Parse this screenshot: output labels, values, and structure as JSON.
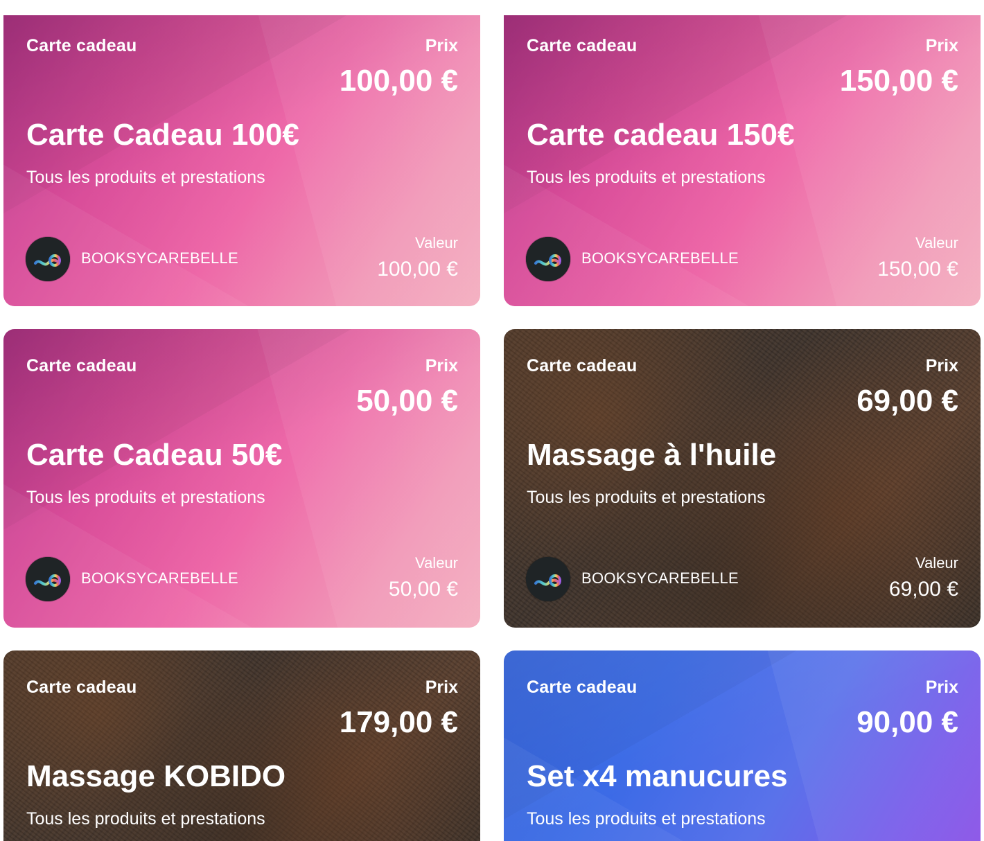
{
  "cards": [
    {
      "type_label": "Carte cadeau",
      "price_label": "Prix",
      "price": "100,00 €",
      "title": "Carte Cadeau 100€",
      "description": "Tous les produits et prestations",
      "brand": "BOOKSYCAREBELLE",
      "value_label": "Valeur",
      "value": "100,00 €",
      "theme": "pink"
    },
    {
      "type_label": "Carte cadeau",
      "price_label": "Prix",
      "price": "150,00 €",
      "title": "Carte cadeau 150€",
      "description": "Tous les produits et prestations",
      "brand": "BOOKSYCAREBELLE",
      "value_label": "Valeur",
      "value": "150,00 €",
      "theme": "pink"
    },
    {
      "type_label": "Carte cadeau",
      "price_label": "Prix",
      "price": "50,00 €",
      "title": "Carte Cadeau 50€",
      "description": "Tous les produits et prestations",
      "brand": "BOOKSYCAREBELLE",
      "value_label": "Valeur",
      "value": "50,00 €",
      "theme": "pink"
    },
    {
      "type_label": "Carte cadeau",
      "price_label": "Prix",
      "price": "69,00 €",
      "title": "Massage à l'huile",
      "description": "Tous les produits et prestations",
      "brand": "BOOKSYCAREBELLE",
      "value_label": "Valeur",
      "value": "69,00 €",
      "theme": "rust"
    },
    {
      "type_label": "Carte cadeau",
      "price_label": "Prix",
      "price": "179,00 €",
      "title": "Massage KOBIDO",
      "description": "Tous les produits et prestations",
      "theme": "rust"
    },
    {
      "type_label": "Carte cadeau",
      "price_label": "Prix",
      "price": "90,00 €",
      "title": "Set x4 manucures",
      "description": "Tous les produits et prestations",
      "theme": "blue"
    }
  ],
  "icons": {
    "avatar": "booksy-b-logo-icon"
  },
  "colors": {
    "pink_start": "#b8368c",
    "pink_end": "#f19bb0",
    "rust": "#4d3a2c",
    "blue_start": "#2e5fd9",
    "blue_end": "#8a4fe6",
    "text": "#ffffff"
  }
}
